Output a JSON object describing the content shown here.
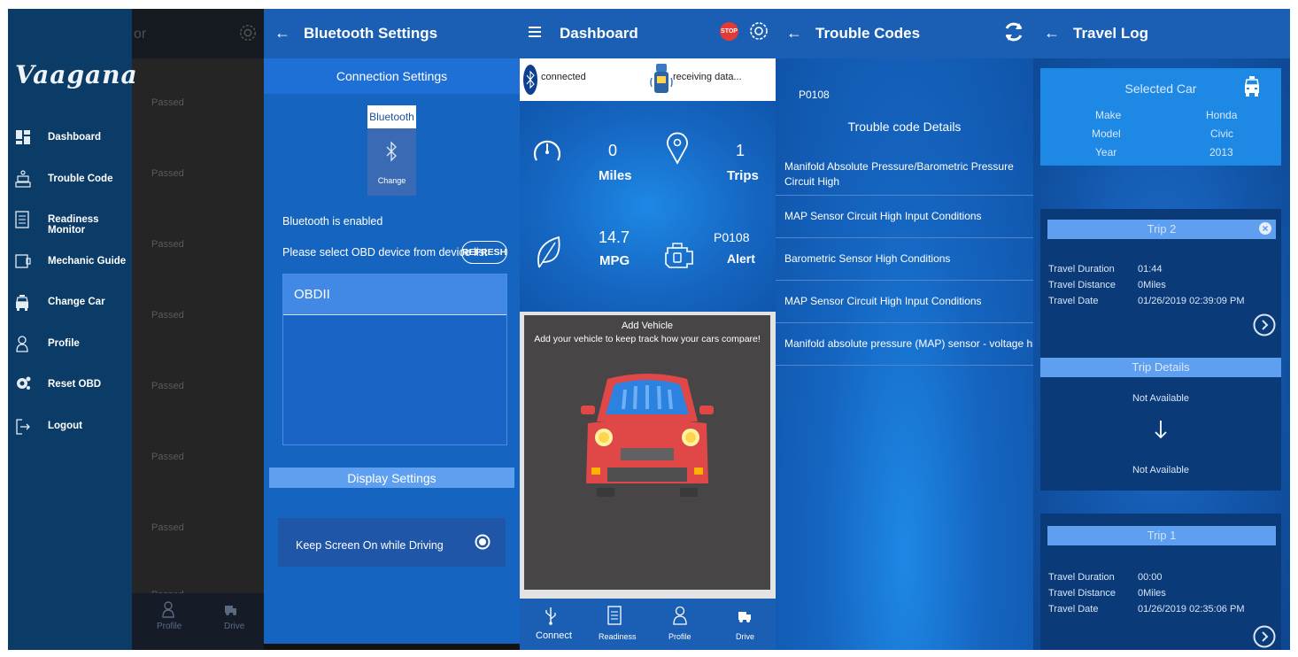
{
  "nav_drawer": {
    "logo": "Vaagana",
    "background_title_fragment": "or",
    "menu": [
      {
        "label": "Dashboard",
        "icon": "dashboard-icon"
      },
      {
        "label": "Trouble Code",
        "icon": "trouble-code-icon"
      },
      {
        "label": "Readiness Monitor",
        "icon": "readiness-icon"
      },
      {
        "label": "Mechanic Guide",
        "icon": "guide-icon"
      },
      {
        "label": "Change Car",
        "icon": "car-icon"
      },
      {
        "label": "Profile",
        "icon": "profile-icon"
      },
      {
        "label": "Reset OBD",
        "icon": "gear-icon"
      },
      {
        "label": "Logout",
        "icon": "logout-icon"
      }
    ],
    "background_rows": [
      "Passed",
      "Passed",
      "Passed",
      "Passed",
      "Passed",
      "Passed",
      "Passed",
      "Passed"
    ],
    "bottom_nav": [
      {
        "label": "Profile"
      },
      {
        "label": "Drive"
      }
    ]
  },
  "bluetooth": {
    "title": "Bluetooth Settings",
    "connection_header": "Connection Settings",
    "bt_card_title": "Bluetooth",
    "bt_card_action": "Change",
    "status": "Bluetooth is enabled",
    "instruction": "Please select OBD device from device list",
    "refresh_label": "REFRESH",
    "devices": [
      "OBDII"
    ],
    "display_header": "Display Settings",
    "keep_screen_label": "Keep Screen On while Driving",
    "keep_screen_on": true
  },
  "dashboard": {
    "title": "Dashboard",
    "stop_label": "STOP",
    "connection_status": "connected",
    "data_status": "receiving data...",
    "stats": [
      {
        "value": "0",
        "label": "Miles",
        "icon": "speedometer-icon"
      },
      {
        "value": "1",
        "label": "Trips",
        "icon": "location-pin-icon"
      },
      {
        "value": "14.7",
        "label": "MPG",
        "icon": "leaf-icon"
      },
      {
        "value": "P0108",
        "label": "Alert",
        "icon": "engine-icon"
      }
    ],
    "add_vehicle_title": "Add Vehicle",
    "add_vehicle_sub": "Add your vehicle to keep track how your cars compare!",
    "bottom_nav": [
      {
        "label": "Connect",
        "icon": "usb-icon"
      },
      {
        "label": "Readiness",
        "icon": "readiness-icon"
      },
      {
        "label": "Profile",
        "icon": "profile-icon"
      },
      {
        "label": "Drive",
        "icon": "truck-icon"
      }
    ]
  },
  "trouble_codes": {
    "title": "Trouble Codes",
    "code": "P0108",
    "details_header": "Trouble code Details",
    "items": [
      "Manifold Absolute Pressure/Barometric Pressure Circuit High",
      "MAP Sensor Circuit High Input Conditions",
      "Barometric Sensor High Conditions",
      "MAP Sensor Circuit High Input Conditions",
      "Manifold absolute pressure (MAP) sensor - voltage high"
    ]
  },
  "travel_log": {
    "title": "Travel Log",
    "selected_car_title": "Selected Car",
    "car": [
      {
        "key": "Make",
        "value": "Honda"
      },
      {
        "key": "Model",
        "value": "Civic"
      },
      {
        "key": "Year",
        "value": "2013"
      }
    ],
    "trips": [
      {
        "name": "Trip 2",
        "duration_label": "Travel Duration",
        "duration": "01:44",
        "distance_label": "Travel Distance",
        "distance": "0Miles",
        "date_label": "Travel Date",
        "date": "01/26/2019 02:39:09 PM"
      },
      {
        "name": "Trip 1",
        "duration_label": "Travel Duration",
        "duration": "00:00",
        "distance_label": "Travel Distance",
        "distance": "0Miles",
        "date_label": "Travel Date",
        "date": "01/26/2019 02:35:06 PM"
      }
    ],
    "trip_details_header": "Trip Details",
    "not_available_1": "Not Available",
    "not_available_2": "Not Available"
  },
  "colors": {
    "primary": "#1565c0",
    "drawer": "#0b3c68",
    "accent_light": "#5e9ff0",
    "stop_red": "#e53935"
  }
}
